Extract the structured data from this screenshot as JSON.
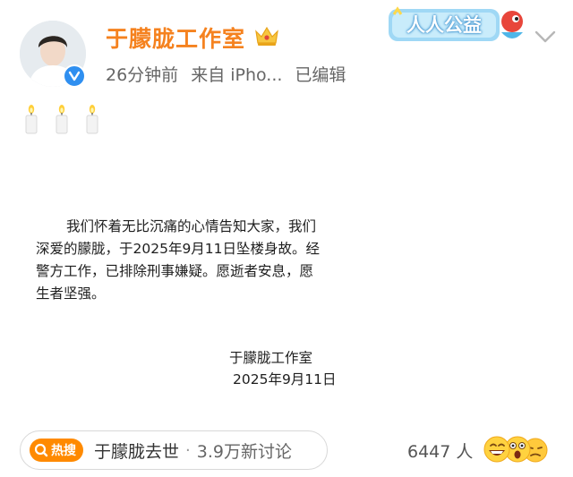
{
  "post": {
    "author": "于朦胧工作室",
    "time_ago": "26分钟前",
    "source": "来自 iPho...",
    "edited": "已编辑",
    "badge_text": "人人公益",
    "candle_count": 3,
    "statement_lines": [
      "我们怀着无比沉痛的心情告知大家，我们",
      "深爱的朦胧，于2025年9月11日坠楼身故。经",
      "警方工作，已排除刑事嫌疑。愿逝者安息，愿",
      "生者坚强。"
    ],
    "signature": "于朦胧工作室",
    "signature_date": "2025年9月11日"
  },
  "topic": {
    "tag": "热搜",
    "title": "于朦胧去世",
    "separator": "·",
    "count": "3.9万新讨论"
  },
  "reactions": {
    "count": "6447 人"
  },
  "colors": {
    "name": "#f5821f",
    "verified": "#2f8ff0",
    "hot_tag": "#ff8a00"
  }
}
